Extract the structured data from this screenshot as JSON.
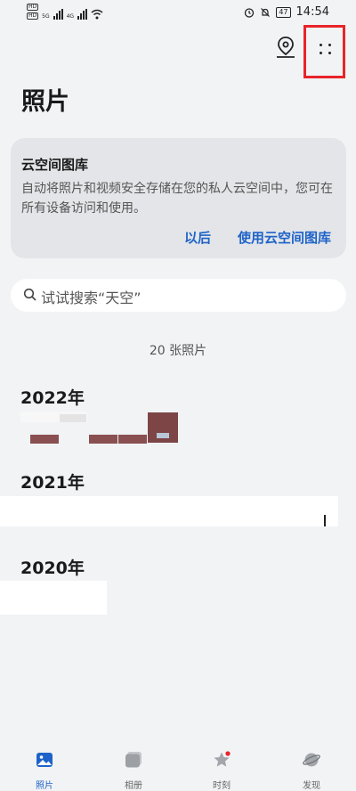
{
  "status_bar": {
    "sim1_top": "HD",
    "sim1_bottom": "HD",
    "network1": "5G",
    "network2": "4G",
    "battery": "47",
    "time": "14:54"
  },
  "header": {
    "title": "照片"
  },
  "cloud_card": {
    "title": "云空间图库",
    "description": "自动将照片和视频安全存储在您的私人云空间中，您可在所有设备访问和使用。",
    "later_label": "以后",
    "use_label": "使用云空间图库"
  },
  "search": {
    "placeholder": "试试搜索“天空”"
  },
  "photo_count": "20 张照片",
  "sections": [
    {
      "year": "2022年"
    },
    {
      "year": "2021年"
    },
    {
      "year": "2020年"
    }
  ],
  "tabs": [
    {
      "label": "照片",
      "active": true
    },
    {
      "label": "相册",
      "active": false
    },
    {
      "label": "时刻",
      "active": false
    },
    {
      "label": "发现",
      "active": false
    }
  ],
  "colors": {
    "accent": "#1e63c8",
    "highlight_box": "#e8242a",
    "badge": "#e8242a"
  },
  "icons": {
    "location": "location-pin-icon",
    "more": "more-dots-icon",
    "search": "search-icon"
  }
}
